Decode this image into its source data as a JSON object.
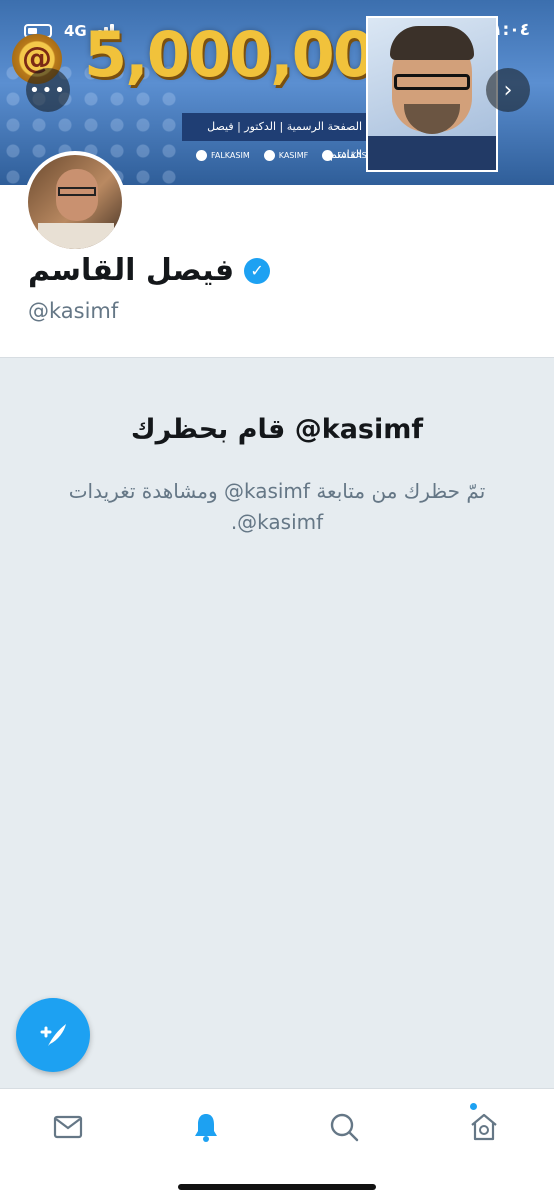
{
  "status_bar": {
    "network": "4G",
    "time": "١:٠٤"
  },
  "banner": {
    "big_number": "5,000,000",
    "ribbon_text": "الصفحة الرسمية | الدكتور | فيصل القاسم",
    "social": [
      {
        "icon": "facebook-icon",
        "label": "FALKASIM"
      },
      {
        "icon": "twitter-icon",
        "label": "KASIMF"
      },
      {
        "icon": "instagram-icon",
        "label": "FALKASIM"
      }
    ]
  },
  "profile": {
    "name": "فيصل القاسم",
    "handle": "@kasimf",
    "verified": true
  },
  "blocked": {
    "title": "kasimf@ قام بحظرك",
    "description": "تمّ حظرك من متابعة kasimf@ ومشاهدة تغريدات kasimf@."
  },
  "tabs": [
    "mail-icon",
    "bell-icon",
    "search-icon",
    "home-icon"
  ],
  "colors": {
    "accent": "#1da1f2",
    "background": "#e6ecf0",
    "text": "#14171a",
    "muted": "#657786"
  }
}
